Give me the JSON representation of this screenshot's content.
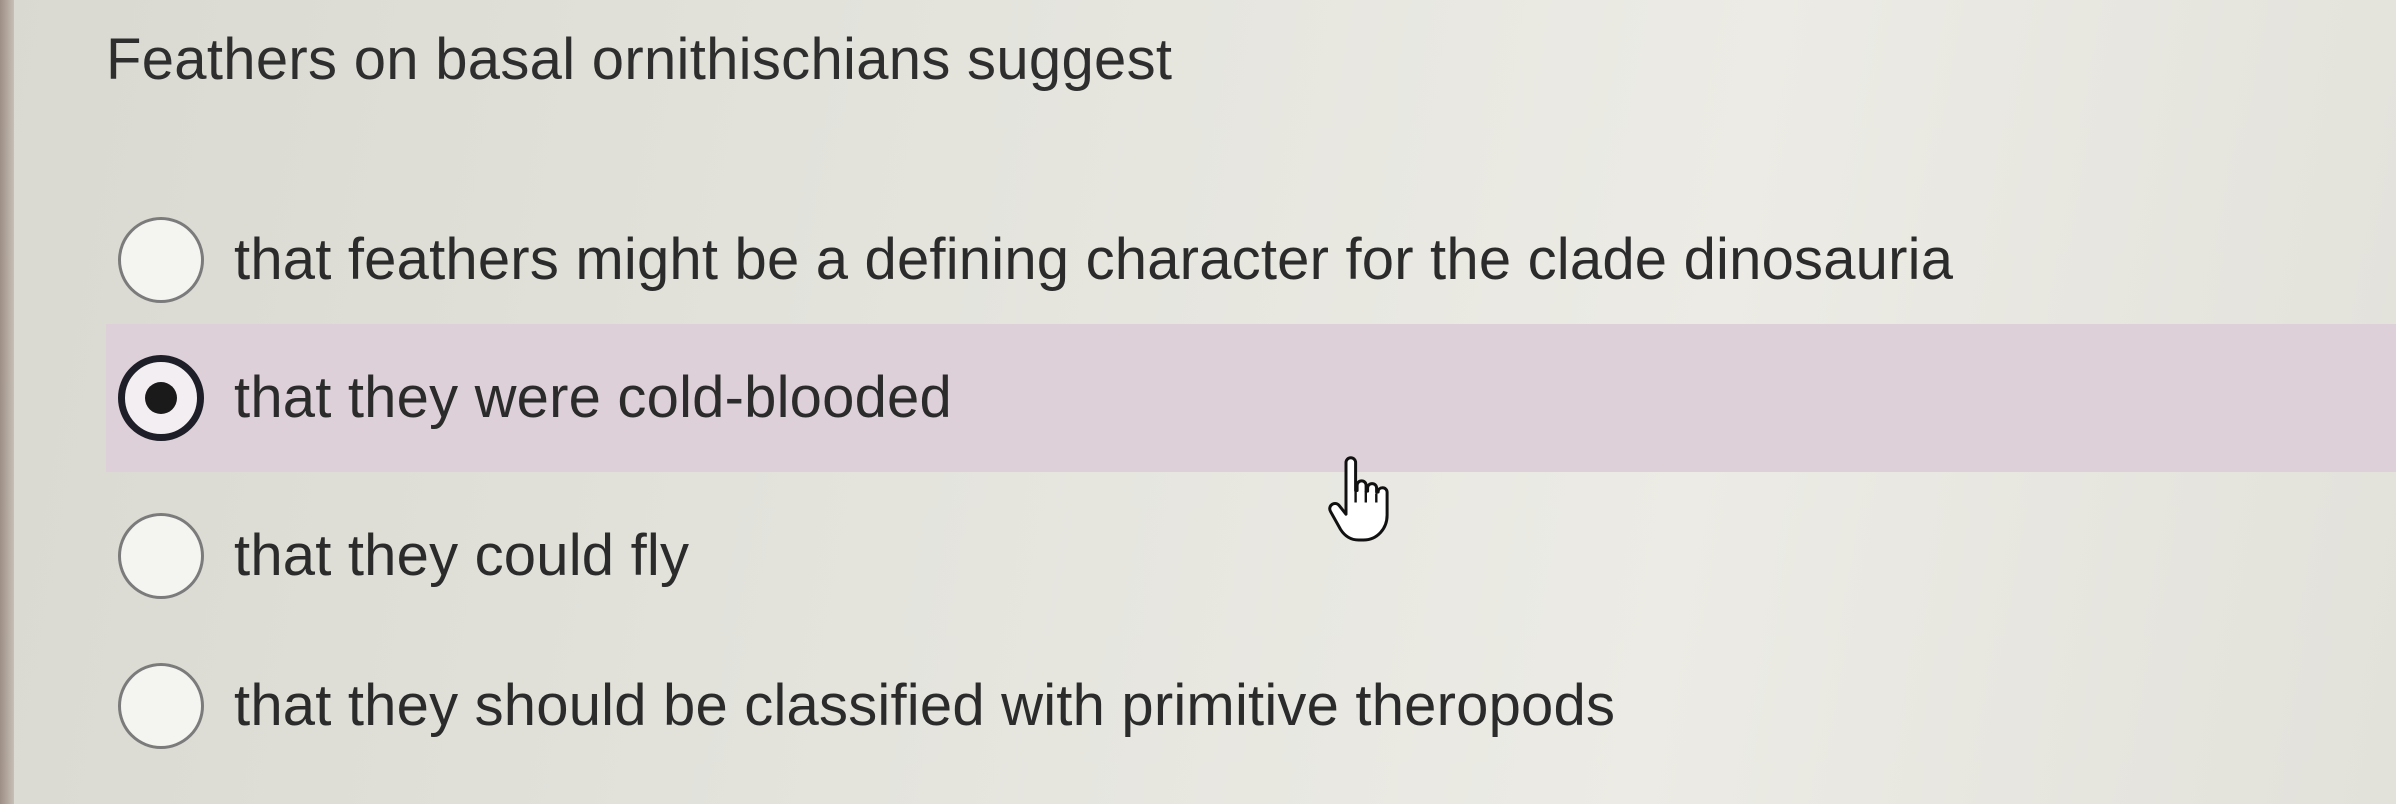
{
  "question": {
    "text": "Feathers on basal ornithischians suggest"
  },
  "options": [
    {
      "label": "that feathers might be a defining character for the clade dinosauria",
      "selected": false
    },
    {
      "label": "that they were cold-blooded",
      "selected": true
    },
    {
      "label": "that they could fly",
      "selected": false
    },
    {
      "label": "that they should be classified with primitive theropods",
      "selected": false
    }
  ],
  "colors": {
    "highlight": "#ddd0d8",
    "radio_checked": "#1e1e28",
    "text": "#2b2b2b"
  },
  "icons": {
    "cursor": "hand-pointer-icon"
  }
}
